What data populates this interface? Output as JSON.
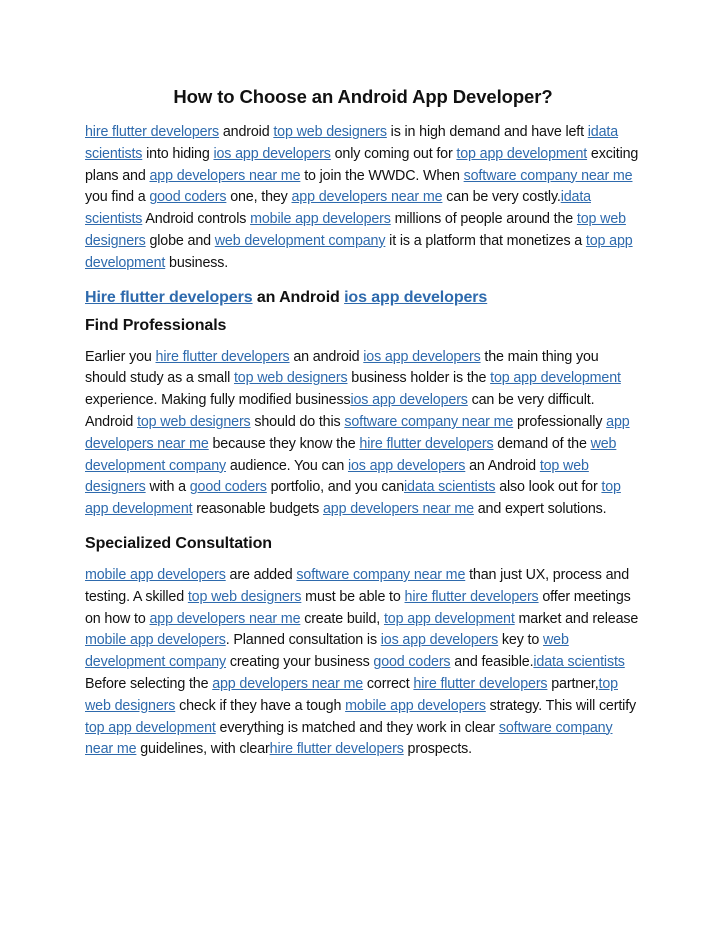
{
  "title": "How to Choose an Android App Developer?",
  "link_color": "#2e6aad",
  "paragraph1": [
    {
      "t": "link",
      "v": "hire flutter developers"
    },
    {
      "t": "text",
      "v": " android "
    },
    {
      "t": "link",
      "v": "top web designers"
    },
    {
      "t": "text",
      "v": " is in high demand and have left "
    },
    {
      "t": "link",
      "v": "idata scientists"
    },
    {
      "t": "text",
      "v": " into hiding "
    },
    {
      "t": "link",
      "v": "ios app developers"
    },
    {
      "t": "text",
      "v": " only coming out for "
    },
    {
      "t": "link",
      "v": "top app development"
    },
    {
      "t": "text",
      "v": " exciting plans and "
    },
    {
      "t": "link",
      "v": "app developers near me"
    },
    {
      "t": "text",
      "v": " to join the WWDC. When "
    },
    {
      "t": "link",
      "v": "software company near me"
    },
    {
      "t": "text",
      "v": " you find a "
    },
    {
      "t": "link",
      "v": "good coders"
    },
    {
      "t": "text",
      "v": " one, they "
    },
    {
      "t": "link",
      "v": "app developers near me"
    },
    {
      "t": "text",
      "v": " can be very costly."
    },
    {
      "t": "link",
      "v": "idata scientists"
    },
    {
      "t": "text",
      "v": " Android controls "
    },
    {
      "t": "link",
      "v": "mobile app developers"
    },
    {
      "t": "text",
      "v": " millions of people around the "
    },
    {
      "t": "link",
      "v": "top web designers"
    },
    {
      "t": "text",
      "v": " globe and "
    },
    {
      "t": "link",
      "v": "web development company"
    },
    {
      "t": "text",
      "v": " it is a platform that monetizes a "
    },
    {
      "t": "link",
      "v": "top app development"
    },
    {
      "t": "text",
      "v": " business."
    }
  ],
  "heading2": [
    {
      "t": "link",
      "v": "Hire flutter developers"
    },
    {
      "t": "text",
      "v": " an Android "
    },
    {
      "t": "link",
      "v": "ios app developers"
    }
  ],
  "section1_heading": "Find Professionals",
  "paragraph2": [
    {
      "t": "text",
      "v": "Earlier you "
    },
    {
      "t": "link",
      "v": "hire flutter developers"
    },
    {
      "t": "text",
      "v": " an android "
    },
    {
      "t": "link",
      "v": "ios app developers"
    },
    {
      "t": "text",
      "v": " the main thing you should study as a small "
    },
    {
      "t": "link",
      "v": "top web designers"
    },
    {
      "t": "text",
      "v": " business holder is the "
    },
    {
      "t": "link",
      "v": "top app development"
    },
    {
      "t": "text",
      "v": " experience. Making fully modified business"
    },
    {
      "t": "link",
      "v": "ios app developers"
    },
    {
      "t": "text",
      "v": " can be very difficult. Android "
    },
    {
      "t": "link",
      "v": "top web designers"
    },
    {
      "t": "text",
      "v": " should do this "
    },
    {
      "t": "link",
      "v": "software company near me"
    },
    {
      "t": "text",
      "v": " professionally "
    },
    {
      "t": "link",
      "v": "app developers near me"
    },
    {
      "t": "text",
      "v": " because they know the "
    },
    {
      "t": "link",
      "v": "hire flutter developers"
    },
    {
      "t": "text",
      "v": " demand of the "
    },
    {
      "t": "link",
      "v": "web development company"
    },
    {
      "t": "text",
      "v": " audience. You can "
    },
    {
      "t": "link",
      "v": "ios app developers"
    },
    {
      "t": "text",
      "v": " an Android "
    },
    {
      "t": "link",
      "v": "top web designers"
    },
    {
      "t": "text",
      "v": " with a "
    },
    {
      "t": "link",
      "v": "good coders"
    },
    {
      "t": "text",
      "v": " portfolio, and you can"
    },
    {
      "t": "link",
      "v": "idata scientists"
    },
    {
      "t": "text",
      "v": " also look out for "
    },
    {
      "t": "link",
      "v": "top app development"
    },
    {
      "t": "text",
      "v": " reasonable budgets "
    },
    {
      "t": "link",
      "v": "app developers near me"
    },
    {
      "t": "text",
      "v": " and expert solutions."
    }
  ],
  "section2_heading": "Specialized Consultation",
  "paragraph3": [
    {
      "t": "link",
      "v": "mobile app developers"
    },
    {
      "t": "text",
      "v": " are added "
    },
    {
      "t": "link",
      "v": "software company near me"
    },
    {
      "t": "text",
      "v": " than just UX, process and testing. A skilled "
    },
    {
      "t": "link",
      "v": "top web designers"
    },
    {
      "t": "text",
      "v": " must be able to "
    },
    {
      "t": "link",
      "v": "hire flutter developers"
    },
    {
      "t": "text",
      "v": " offer meetings on how to "
    },
    {
      "t": "link",
      "v": "app developers near me"
    },
    {
      "t": "text",
      "v": " create build, "
    },
    {
      "t": "link",
      "v": "top app development"
    },
    {
      "t": "text",
      "v": " market and release "
    },
    {
      "t": "link",
      "v": "mobile app developers"
    },
    {
      "t": "text",
      "v": ". Planned consultation is "
    },
    {
      "t": "link",
      "v": "ios app developers"
    },
    {
      "t": "text",
      "v": " key to "
    },
    {
      "t": "link",
      "v": "web development company"
    },
    {
      "t": "text",
      "v": " creating your business "
    },
    {
      "t": "link",
      "v": "good coders"
    },
    {
      "t": "text",
      "v": " and feasible."
    },
    {
      "t": "link",
      "v": "idata scientists"
    },
    {
      "t": "text",
      "v": " Before selecting the "
    },
    {
      "t": "link",
      "v": "app developers near me"
    },
    {
      "t": "text",
      "v": " correct "
    },
    {
      "t": "link",
      "v": "hire flutter developers"
    },
    {
      "t": "text",
      "v": " partner,"
    },
    {
      "t": "link",
      "v": "top web designers"
    },
    {
      "t": "text",
      "v": " check if they have a tough "
    },
    {
      "t": "link",
      "v": "mobile app developers"
    },
    {
      "t": "text",
      "v": " strategy. This will certify "
    },
    {
      "t": "link",
      "v": "top app development"
    },
    {
      "t": "text",
      "v": " everything is matched and they work in clear "
    },
    {
      "t": "link",
      "v": "software company near me"
    },
    {
      "t": "text",
      "v": " guidelines, with clear"
    },
    {
      "t": "link",
      "v": "hire flutter developers"
    },
    {
      "t": "text",
      "v": " prospects."
    }
  ]
}
